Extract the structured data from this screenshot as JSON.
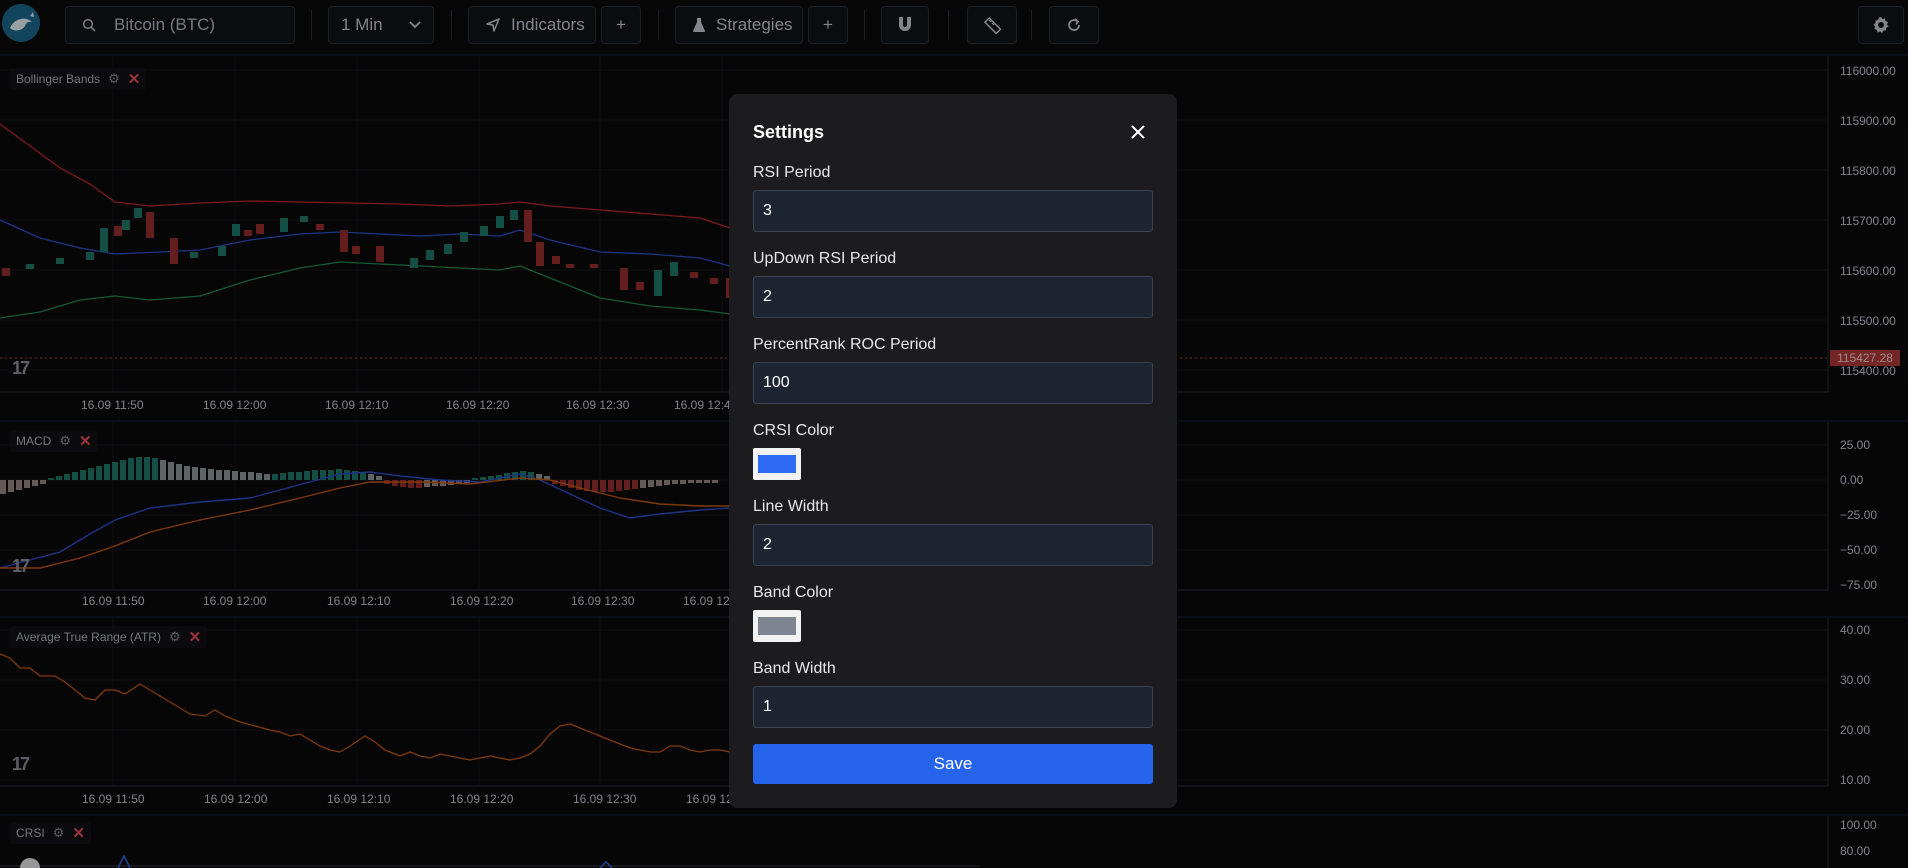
{
  "toolbar": {
    "symbol": "Bitcoin (BTC)",
    "interval": "1 Min",
    "indicators_label": "Indicators",
    "strategies_label": "Strategies",
    "plus_label": "+"
  },
  "panes": {
    "bollinger": {
      "title": "Bollinger Bands",
      "y_ticks": [
        "116000.00",
        "115900.00",
        "115800.00",
        "115700.00",
        "115600.00",
        "115500.00",
        "115400.00"
      ],
      "last_price": "115427.28",
      "time_ticks": [
        "16.09 11:50",
        "16.09 12:00",
        "16.09 12:10",
        "16.09 12:20",
        "16.09 12:30",
        "16.09 12:4"
      ]
    },
    "macd": {
      "title": "MACD",
      "y_ticks": [
        "25.00",
        "0.00",
        "−25.00",
        "−50.00",
        "−75.00"
      ],
      "time_ticks": [
        "16.09 11:50",
        "16.09 12:00",
        "16.09 12:10",
        "16.09 12:20",
        "16.09 12:30",
        "16.09 12"
      ]
    },
    "atr": {
      "title": "Average True Range (ATR)",
      "y_ticks": [
        "40.00",
        "30.00",
        "20.00",
        "10.00"
      ],
      "time_ticks": [
        "16.09 11:50",
        "16.09 12:00",
        "16.09 12:10",
        "16.09 12:20",
        "16.09 12:30",
        "16.09 12"
      ]
    },
    "crsi": {
      "title": "CRSI",
      "y_ticks": [
        "100.00",
        "80.00"
      ]
    }
  },
  "modal": {
    "title": "Settings",
    "rsi_period_label": "RSI Period",
    "rsi_period_value": "3",
    "updown_label": "UpDown RSI Period",
    "updown_value": "2",
    "roc_label": "PercentRank ROC Period",
    "roc_value": "100",
    "crsi_color_label": "CRSI Color",
    "crsi_color": "#2f6bf2",
    "line_width_label": "Line Width",
    "line_width_value": "2",
    "band_color_label": "Band Color",
    "band_color": "#7f8590",
    "band_width_label": "Band Width",
    "band_width_value": "1",
    "save_label": "Save"
  },
  "colors": {
    "accent": "#2563eb",
    "candle_up": "#1f7a6b",
    "candle_down": "#9b2f2f",
    "band_upper": "#c4262e",
    "band_mid": "#2d4fcf",
    "band_lower": "#1f8a55",
    "atr_line": "#c45a12"
  }
}
